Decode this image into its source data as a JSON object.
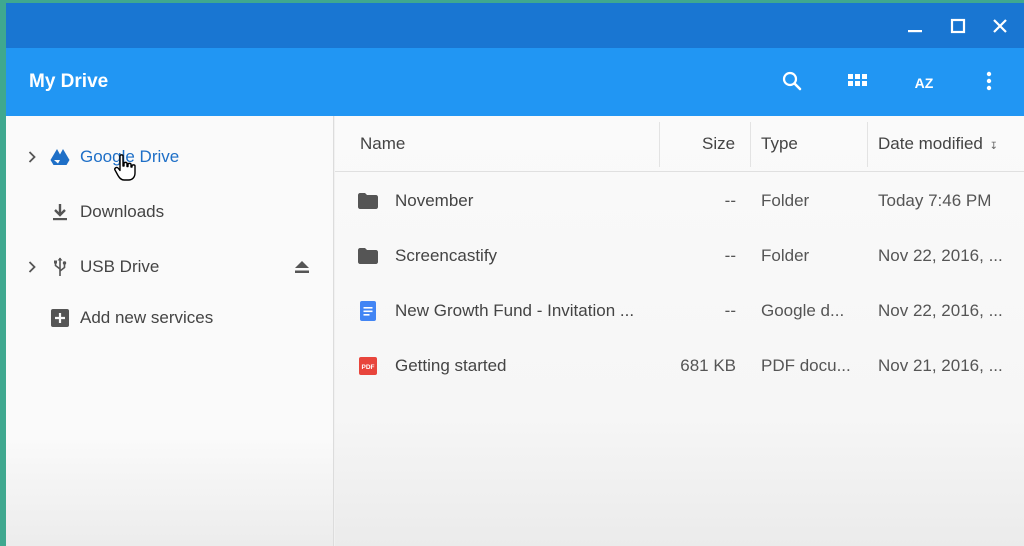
{
  "window": {
    "title": "My Drive",
    "controls": {
      "minimize": "minimize-icon",
      "maximize": "maximize-icon",
      "close": "close-icon"
    }
  },
  "toolbar": {
    "search_icon": "search-icon",
    "grid_icon": "grid-view-icon",
    "sort_label": "AZ",
    "more_icon": "more-vert-icon"
  },
  "sidebar": {
    "items": [
      {
        "label": "Google Drive",
        "icon": "google-drive-icon",
        "expandable": true,
        "active": true
      },
      {
        "label": "Downloads",
        "icon": "download-icon",
        "expandable": false
      },
      {
        "label": "USB Drive",
        "icon": "usb-icon",
        "expandable": true,
        "eject": true
      },
      {
        "label": "Add new services",
        "icon": "add-box-icon",
        "expandable": false
      }
    ]
  },
  "columns": {
    "name": "Name",
    "size": "Size",
    "type": "Type",
    "date": "Date modified"
  },
  "files": [
    {
      "name": "November",
      "icon": "folder-icon",
      "size": "--",
      "type": "Folder",
      "date": "Today 7:46 PM"
    },
    {
      "name": "Screencastify",
      "icon": "folder-icon",
      "size": "--",
      "type": "Folder",
      "date": "Nov 22, 2016, ..."
    },
    {
      "name": "New Growth Fund - Invitation ...",
      "icon": "google-doc-icon",
      "size": "--",
      "type": "Google d...",
      "date": "Nov 22, 2016, ..."
    },
    {
      "name": "Getting started",
      "icon": "pdf-icon",
      "size": "681 KB",
      "type": "PDF docu...",
      "date": "Nov 21, 2016, ..."
    }
  ],
  "colors": {
    "titlebar": "#1976d2",
    "appbar": "#2196f3",
    "accent_text": "#1e6fc7",
    "pdf_red": "#e8453c",
    "doc_blue": "#4285f4"
  },
  "pdf_badge": "PDF"
}
